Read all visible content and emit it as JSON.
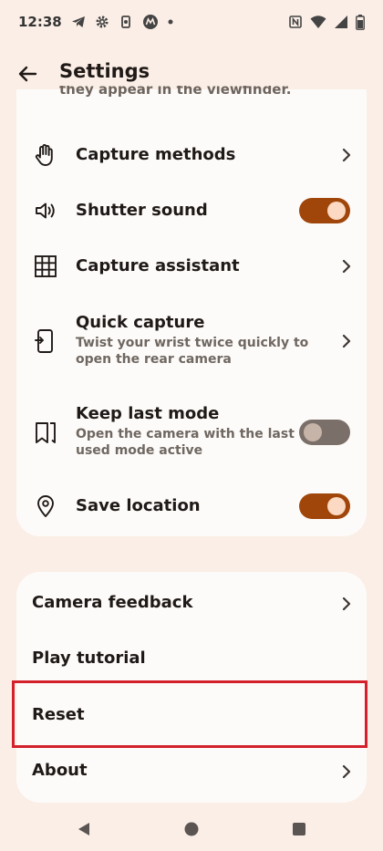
{
  "status_bar": {
    "time": "12:38",
    "left_icons": [
      "telegram-icon",
      "settings-gear-icon",
      "screen-rotate-icon",
      "motorola-icon",
      "dot-icon"
    ],
    "right_icons": [
      "nfc-icon",
      "wifi-icon",
      "signal-icon",
      "battery-icon"
    ]
  },
  "header": {
    "title": "Settings",
    "back_icon": "arrow-left-icon"
  },
  "clipped_text": "they appear in the viewfinder.",
  "settings_items": [
    {
      "title": "Capture methods",
      "subtitle": "",
      "icon": "hand-icon",
      "control": "chevron"
    },
    {
      "title": "Shutter sound",
      "subtitle": "",
      "icon": "speaker-icon",
      "control": "toggle",
      "state": "on"
    },
    {
      "title": "Capture assistant",
      "subtitle": "",
      "icon": "grid-icon",
      "control": "chevron"
    },
    {
      "title": "Quick capture",
      "subtitle": "Twist your wrist twice quickly to open the rear camera",
      "icon": "phone-twist-icon",
      "control": "chevron"
    },
    {
      "title": "Keep last mode",
      "subtitle": "Open the camera with the last used mode active",
      "icon": "bookmark-icon",
      "control": "toggle",
      "state": "off"
    },
    {
      "title": "Save location",
      "subtitle": "",
      "icon": "location-pin-icon",
      "control": "toggle",
      "state": "on"
    }
  ],
  "more_items": [
    {
      "title": "Camera feedback",
      "control": "chevron"
    },
    {
      "title": "Play tutorial",
      "control": "none"
    },
    {
      "title": "Reset",
      "control": "none",
      "highlighted": true
    },
    {
      "title": "About",
      "control": "chevron"
    }
  ],
  "colors": {
    "background": "#fbeee6",
    "card": "#fdfbf9",
    "toggle_on": "#a0460b",
    "toggle_off": "#7b6f69",
    "highlight": "#d3202b"
  },
  "nav_bar": {
    "buttons": [
      "back-triangle-icon",
      "home-circle-icon",
      "recents-square-icon"
    ]
  }
}
